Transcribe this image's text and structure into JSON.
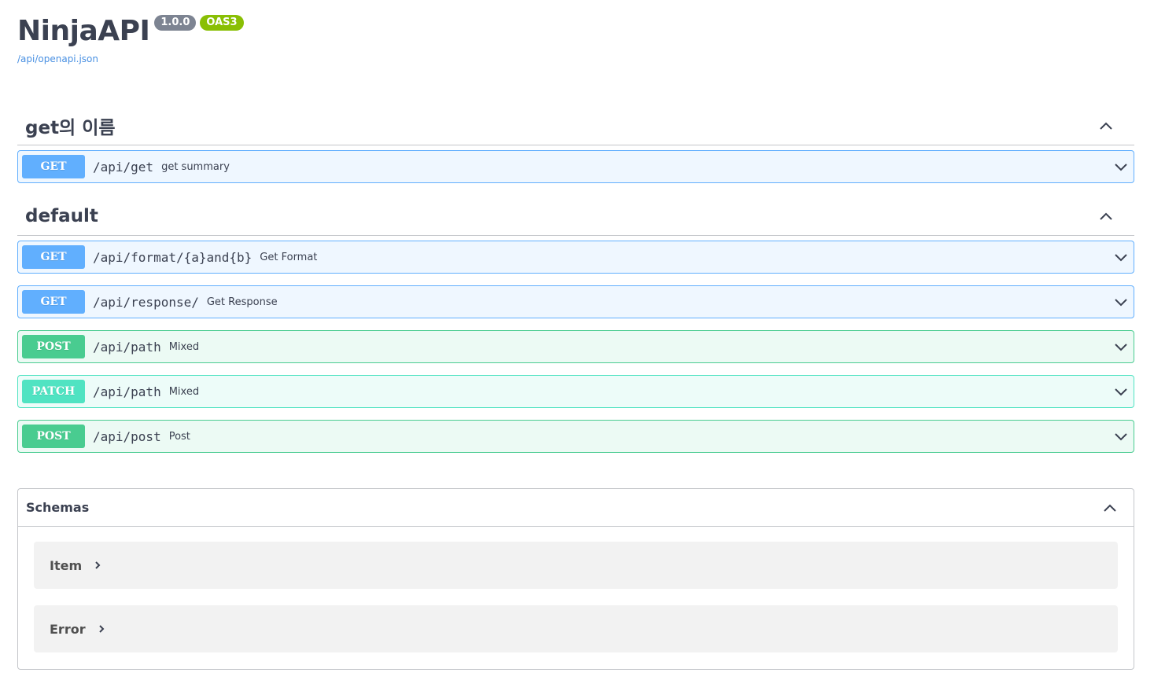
{
  "info": {
    "title": "NinjaAPI",
    "version": "1.0.0",
    "oas_badge": "OAS3",
    "spec_url": "/api/openapi.json"
  },
  "tags": [
    {
      "name": "get의 이름",
      "operations": [
        {
          "method": "GET",
          "path": "/api/get",
          "summary": "get summary"
        }
      ]
    },
    {
      "name": "default",
      "operations": [
        {
          "method": "GET",
          "path": "/api/format/{a}and{b}",
          "summary": "Get Format"
        },
        {
          "method": "GET",
          "path": "/api/response/",
          "summary": "Get Response"
        },
        {
          "method": "POST",
          "path": "/api/path",
          "summary": "Mixed"
        },
        {
          "method": "PATCH",
          "path": "/api/path",
          "summary": "Mixed"
        },
        {
          "method": "POST",
          "path": "/api/post",
          "summary": "Post"
        }
      ]
    }
  ],
  "schemas": {
    "title": "Schemas",
    "models": [
      "Item",
      "Error"
    ]
  },
  "colors": {
    "get": "#61affe",
    "post": "#49cc90",
    "patch": "#50e3c2",
    "text": "#3b4151",
    "link": "#4990e2",
    "version_badge": "#7d8492",
    "oas_badge": "#89bf04"
  },
  "icons": {
    "section_toggle": "chevron-up-icon",
    "operation_toggle": "chevron-down-icon",
    "model_toggle": "chevron-right-icon"
  }
}
